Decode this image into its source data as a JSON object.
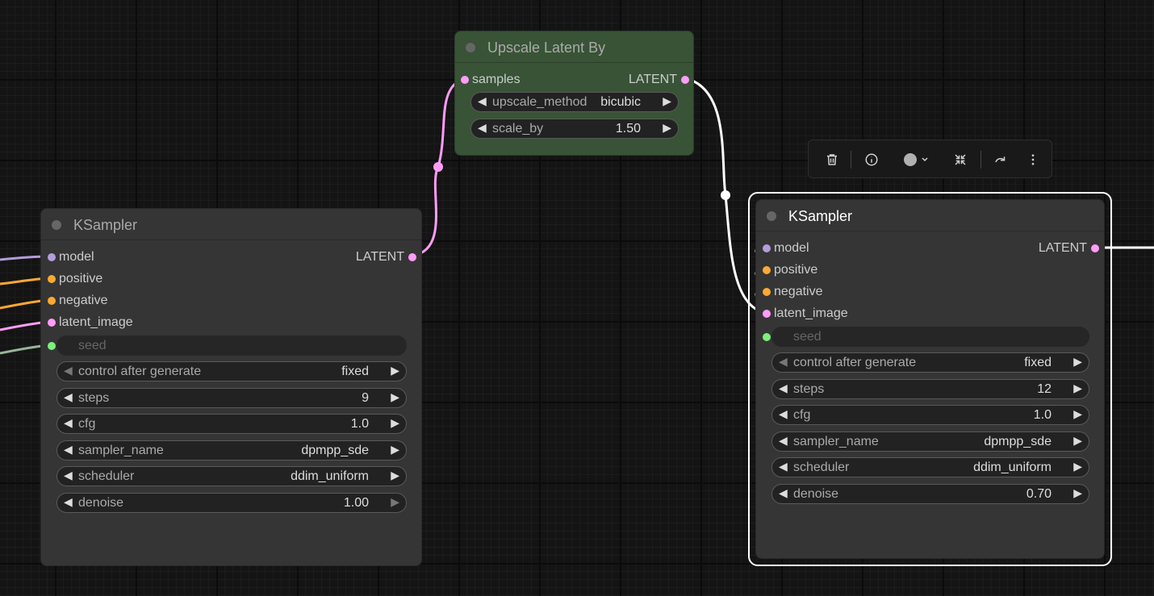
{
  "upscale_node": {
    "title": "Upscale Latent By",
    "input": "samples",
    "output": "LATENT",
    "widgets": [
      {
        "label": "upscale_method",
        "value": "bicubic"
      },
      {
        "label": "scale_by",
        "value": "1.50"
      }
    ]
  },
  "ksampler_left": {
    "title": "KSampler",
    "output": "LATENT",
    "inputs": [
      "model",
      "positive",
      "negative",
      "latent_image"
    ],
    "seed_label": "seed",
    "widgets": [
      {
        "label": "control after generate",
        "value": "fixed"
      },
      {
        "label": "steps",
        "value": "9"
      },
      {
        "label": "cfg",
        "value": "1.0"
      },
      {
        "label": "sampler_name",
        "value": "dpmpp_sde"
      },
      {
        "label": "scheduler",
        "value": "ddim_uniform"
      },
      {
        "label": "denoise",
        "value": "1.00"
      }
    ]
  },
  "ksampler_right": {
    "title": "KSampler",
    "output": "LATENT",
    "inputs": [
      "model",
      "positive",
      "negative",
      "latent_image"
    ],
    "seed_label": "seed",
    "widgets": [
      {
        "label": "control after generate",
        "value": "fixed"
      },
      {
        "label": "steps",
        "value": "12"
      },
      {
        "label": "cfg",
        "value": "1.0"
      },
      {
        "label": "sampler_name",
        "value": "dpmpp_sde"
      },
      {
        "label": "scheduler",
        "value": "ddim_uniform"
      },
      {
        "label": "denoise",
        "value": "0.70"
      }
    ]
  },
  "toolbar": {
    "buttons": [
      "trash-icon",
      "info-icon",
      "color-picker-icon",
      "collapse-icon",
      "bypass-icon",
      "more-vertical-icon"
    ]
  },
  "colors": {
    "model": "#b39ddb",
    "conditioning": "#ffa931",
    "latent": "#ff9cf9",
    "int": "#7cf07c",
    "upscale_node_bg": "#385336",
    "node_bg": "#353535",
    "selection_outline": "#ffffff"
  }
}
